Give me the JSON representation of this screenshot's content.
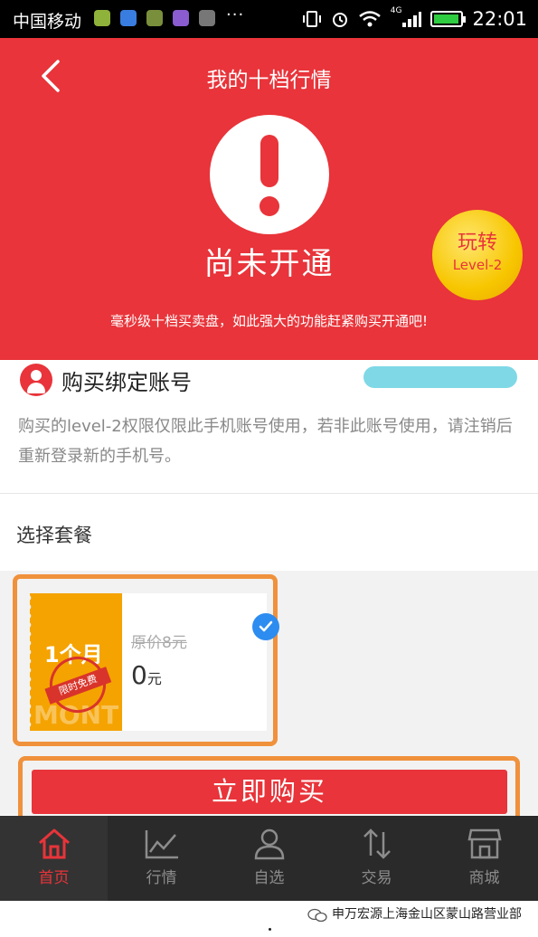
{
  "status_bar": {
    "carrier": "中国移动",
    "more": "···",
    "network": "4G",
    "time": "22:01",
    "battery_level": 0.95
  },
  "header": {
    "title": "我的十档行情",
    "status": "尚未开通",
    "description": "毫秒级十档买卖盘，如此强大的功能赶紧购买开通吧!",
    "badge_line1": "玩转",
    "badge_line2": "Level-2"
  },
  "account": {
    "title": "购买绑定账号",
    "note": "购买的level-2权限仅限此手机账号使用，若非此账号使用，请注销后重新登录新的手机号。"
  },
  "plans": {
    "title": "选择套餐",
    "items": [
      {
        "period": "1个月",
        "watermark": "MONT",
        "stamp": "限时免费",
        "original_price": "原价8元",
        "price": "0",
        "unit": "元",
        "selected": true
      }
    ]
  },
  "buy_button": "立即购买",
  "nav": {
    "items": [
      {
        "label": "首页",
        "icon": "home-icon"
      },
      {
        "label": "行情",
        "icon": "chart-icon"
      },
      {
        "label": "自选",
        "icon": "user-icon"
      },
      {
        "label": "交易",
        "icon": "transfer-icon"
      },
      {
        "label": "商城",
        "icon": "store-icon"
      }
    ]
  },
  "footer": {
    "text": "申万宏源上海金山区蒙山路营业部"
  },
  "colors": {
    "brand_red": "#e8343a",
    "accent_orange": "#f0913c",
    "plan_orange": "#f5a300",
    "check_blue": "#2d8cf0"
  }
}
